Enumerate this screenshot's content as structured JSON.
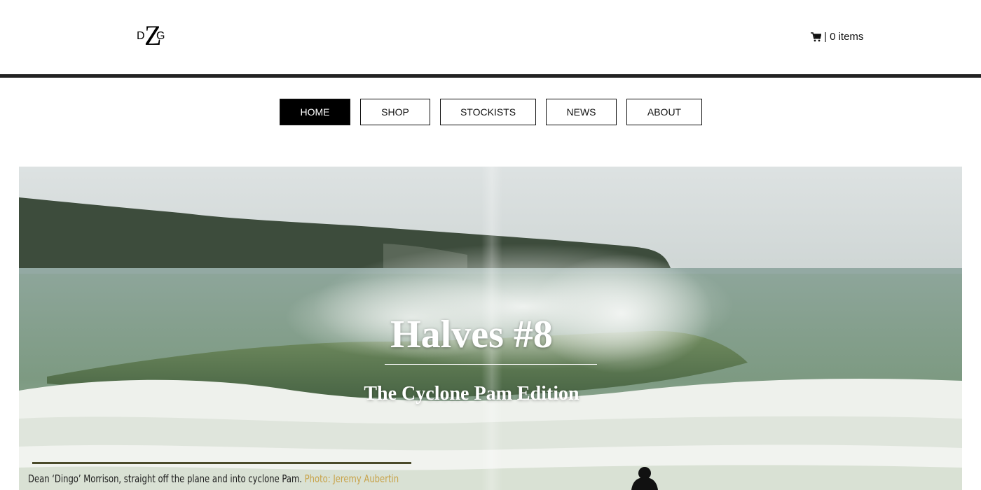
{
  "header": {
    "logo": {
      "left": "D",
      "middle": "Z",
      "right": "G"
    },
    "cart": {
      "icon": "cart-icon",
      "text": "| 0 items"
    }
  },
  "nav": {
    "items": [
      {
        "label": "HOME",
        "active": true
      },
      {
        "label": "SHOP",
        "active": false
      },
      {
        "label": "STOCKISTS",
        "active": false
      },
      {
        "label": "NEWS",
        "active": false
      },
      {
        "label": "ABOUT",
        "active": false
      }
    ]
  },
  "hero": {
    "title": "Halves #8",
    "subtitle": "The Cyclone Pam Edition",
    "caption": "Dean ‘Dingo’ Morrison, straight off the plane and into cyclone Pam.",
    "credit": "Photo: Jeremy Aubertin"
  },
  "colors": {
    "accent_black": "#000000",
    "divider": "#222222",
    "credit_gold": "#c8a34a"
  }
}
